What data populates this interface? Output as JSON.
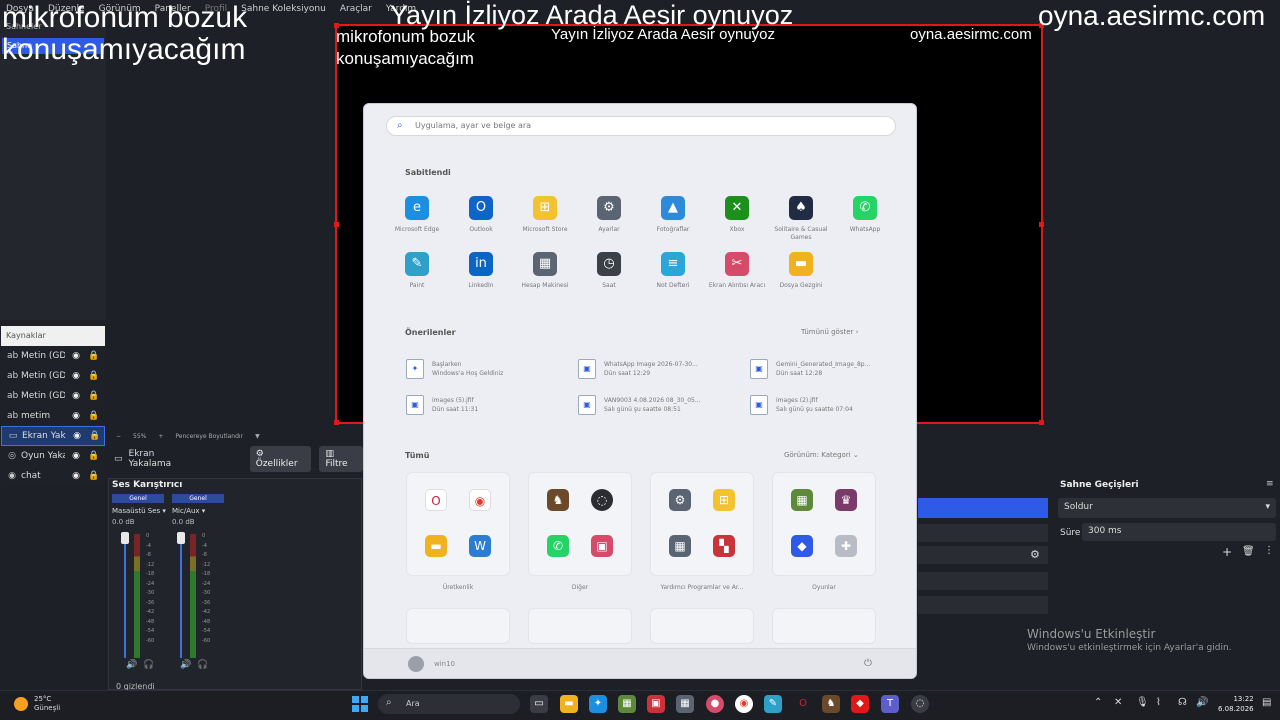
{
  "menubar": {
    "items": [
      "Dosya",
      "Düzenle",
      "Görünüm",
      "Paneller",
      "Profil",
      "Sahne Koleksiyonu",
      "Araçlar",
      "Yardım"
    ]
  },
  "overlay": {
    "big_left_1": "mikrofonum bozuk",
    "big_left_2": "konuşamıyacağım",
    "big_mid": "Yayın İzliyoz Arada Aesir oynuyoz",
    "big_right": "oyna.aesirmc.com",
    "small_left_1": "mikrofonum bozuk",
    "small_left_2": "konuşamıyacağım",
    "small_mid": "Yayın İzliyoz Arada Aesir oynuyoz",
    "small_right": "oyna.aesirmc.com"
  },
  "scenes": {
    "header": "Sahneler",
    "items": [
      "Sahne"
    ]
  },
  "sources": {
    "header": "Kaynaklar",
    "items": [
      {
        "name": "Metin (GDI",
        "icon": "ab"
      },
      {
        "name": "Metin (GDI",
        "icon": "ab"
      },
      {
        "name": "Metin (GDI",
        "icon": "ab"
      },
      {
        "name": "metim",
        "icon": "ab"
      },
      {
        "name": "Ekran Yaka",
        "icon": "▭"
      },
      {
        "name": "Oyun Yaka",
        "icon": "◎"
      },
      {
        "name": "chat",
        "icon": "◉"
      }
    ]
  },
  "preview_toolbar": {
    "zoom": "55%",
    "fit": "Pencereye Boyutlandır"
  },
  "props_bar": {
    "source": "Ekran Yakalama",
    "properties": "Özellikler",
    "filters": "Filtre"
  },
  "mixer": {
    "title": "Ses Karıştırıcı",
    "channels": [
      {
        "tag": "Genel",
        "name": "Masaüstü Ses",
        "db": "0.0 dB"
      },
      {
        "tag": "Genel",
        "name": "Mic/Aux",
        "db": "0.0 dB"
      }
    ],
    "ticks": [
      "0",
      "-4",
      "-8",
      "-12",
      "-18",
      "-24",
      "-30",
      "-36",
      "-42",
      "-48",
      "-54",
      "-60"
    ],
    "status": "0 gizlendi"
  },
  "transitions": {
    "title": "Sahne Geçişleri",
    "selected": "Soldur",
    "duration_label": "Süre",
    "duration": "300 ms"
  },
  "activation": {
    "line1": "Windows'u Etkinleştir",
    "line2": "Windows'u etkinleştirmek için Ayarlar'a gidin."
  },
  "start_menu": {
    "search_placeholder": "Uygulama, ayar ve belge ara",
    "pinned_title": "Sabitlendi",
    "pinned": [
      {
        "label": "Microsoft Edge",
        "glyph": "e",
        "color": "#1d8fe0"
      },
      {
        "label": "Outlook",
        "glyph": "O",
        "color": "#0f64c8"
      },
      {
        "label": "Microsoft Store",
        "glyph": "⊞",
        "color": "#f2c230"
      },
      {
        "label": "Ayarlar",
        "glyph": "⚙",
        "color": "#5b6472"
      },
      {
        "label": "Fotoğraflar",
        "glyph": "▲",
        "color": "#2c8ad9"
      },
      {
        "label": "Xbox",
        "glyph": "✕",
        "color": "#1d8f1d"
      },
      {
        "label": "Solitaire & Casual Games",
        "glyph": "♠",
        "color": "#222b44"
      },
      {
        "label": "WhatsApp",
        "glyph": "✆",
        "color": "#25d366"
      },
      {
        "label": "Paint",
        "glyph": "✎",
        "color": "#2fa0c8"
      },
      {
        "label": "LinkedIn",
        "glyph": "in",
        "color": "#0a66c2"
      },
      {
        "label": "Hesap Makinesi",
        "glyph": "▦",
        "color": "#5b6472"
      },
      {
        "label": "Saat",
        "glyph": "◷",
        "color": "#3b3f46"
      },
      {
        "label": "Not Defteri",
        "glyph": "≡",
        "color": "#2aa7d9"
      },
      {
        "label": "Ekran Alıntısı Aracı",
        "glyph": "✂",
        "color": "#d64a6a"
      },
      {
        "label": "Dosya Gezgini",
        "glyph": "▬",
        "color": "#f1b21f"
      }
    ],
    "recommended_title": "Önerilenler",
    "show_all": "Tümünü göster ›",
    "recommended": [
      {
        "title": "Başlarken",
        "sub": "Windows'a Hoş Geldiniz",
        "glyph": "✦"
      },
      {
        "title": "WhatsApp Image 2026-07-30...",
        "sub": "Dün saat 12:29",
        "glyph": "▣"
      },
      {
        "title": "Gemini_Generated_Image_8p...",
        "sub": "Dün saat 12:28",
        "glyph": "▣"
      },
      {
        "title": "images (5).jfif",
        "sub": "Dün saat 11:31",
        "glyph": "▣"
      },
      {
        "title": "VAN9003 4.08.2026 08_30_05...",
        "sub": "Salı günü şu saatte 08:51",
        "glyph": "▣"
      },
      {
        "title": "images (2).jfif",
        "sub": "Salı günü şu saatte 07:04",
        "glyph": "▣"
      }
    ],
    "all_title": "Tümü",
    "view_label": "Görünüm: Kategori ⌄",
    "folders": [
      {
        "label": "Üretkenlik"
      },
      {
        "label": "Diğer"
      },
      {
        "label": "Yardımcı Programlar ve Ar..."
      },
      {
        "label": "Oyunlar"
      }
    ],
    "user": "win10"
  },
  "taskbar": {
    "temp": "25°C",
    "weather": "Güneşli",
    "search": "Ara",
    "time": "13:22",
    "date": "6.08.2026"
  }
}
